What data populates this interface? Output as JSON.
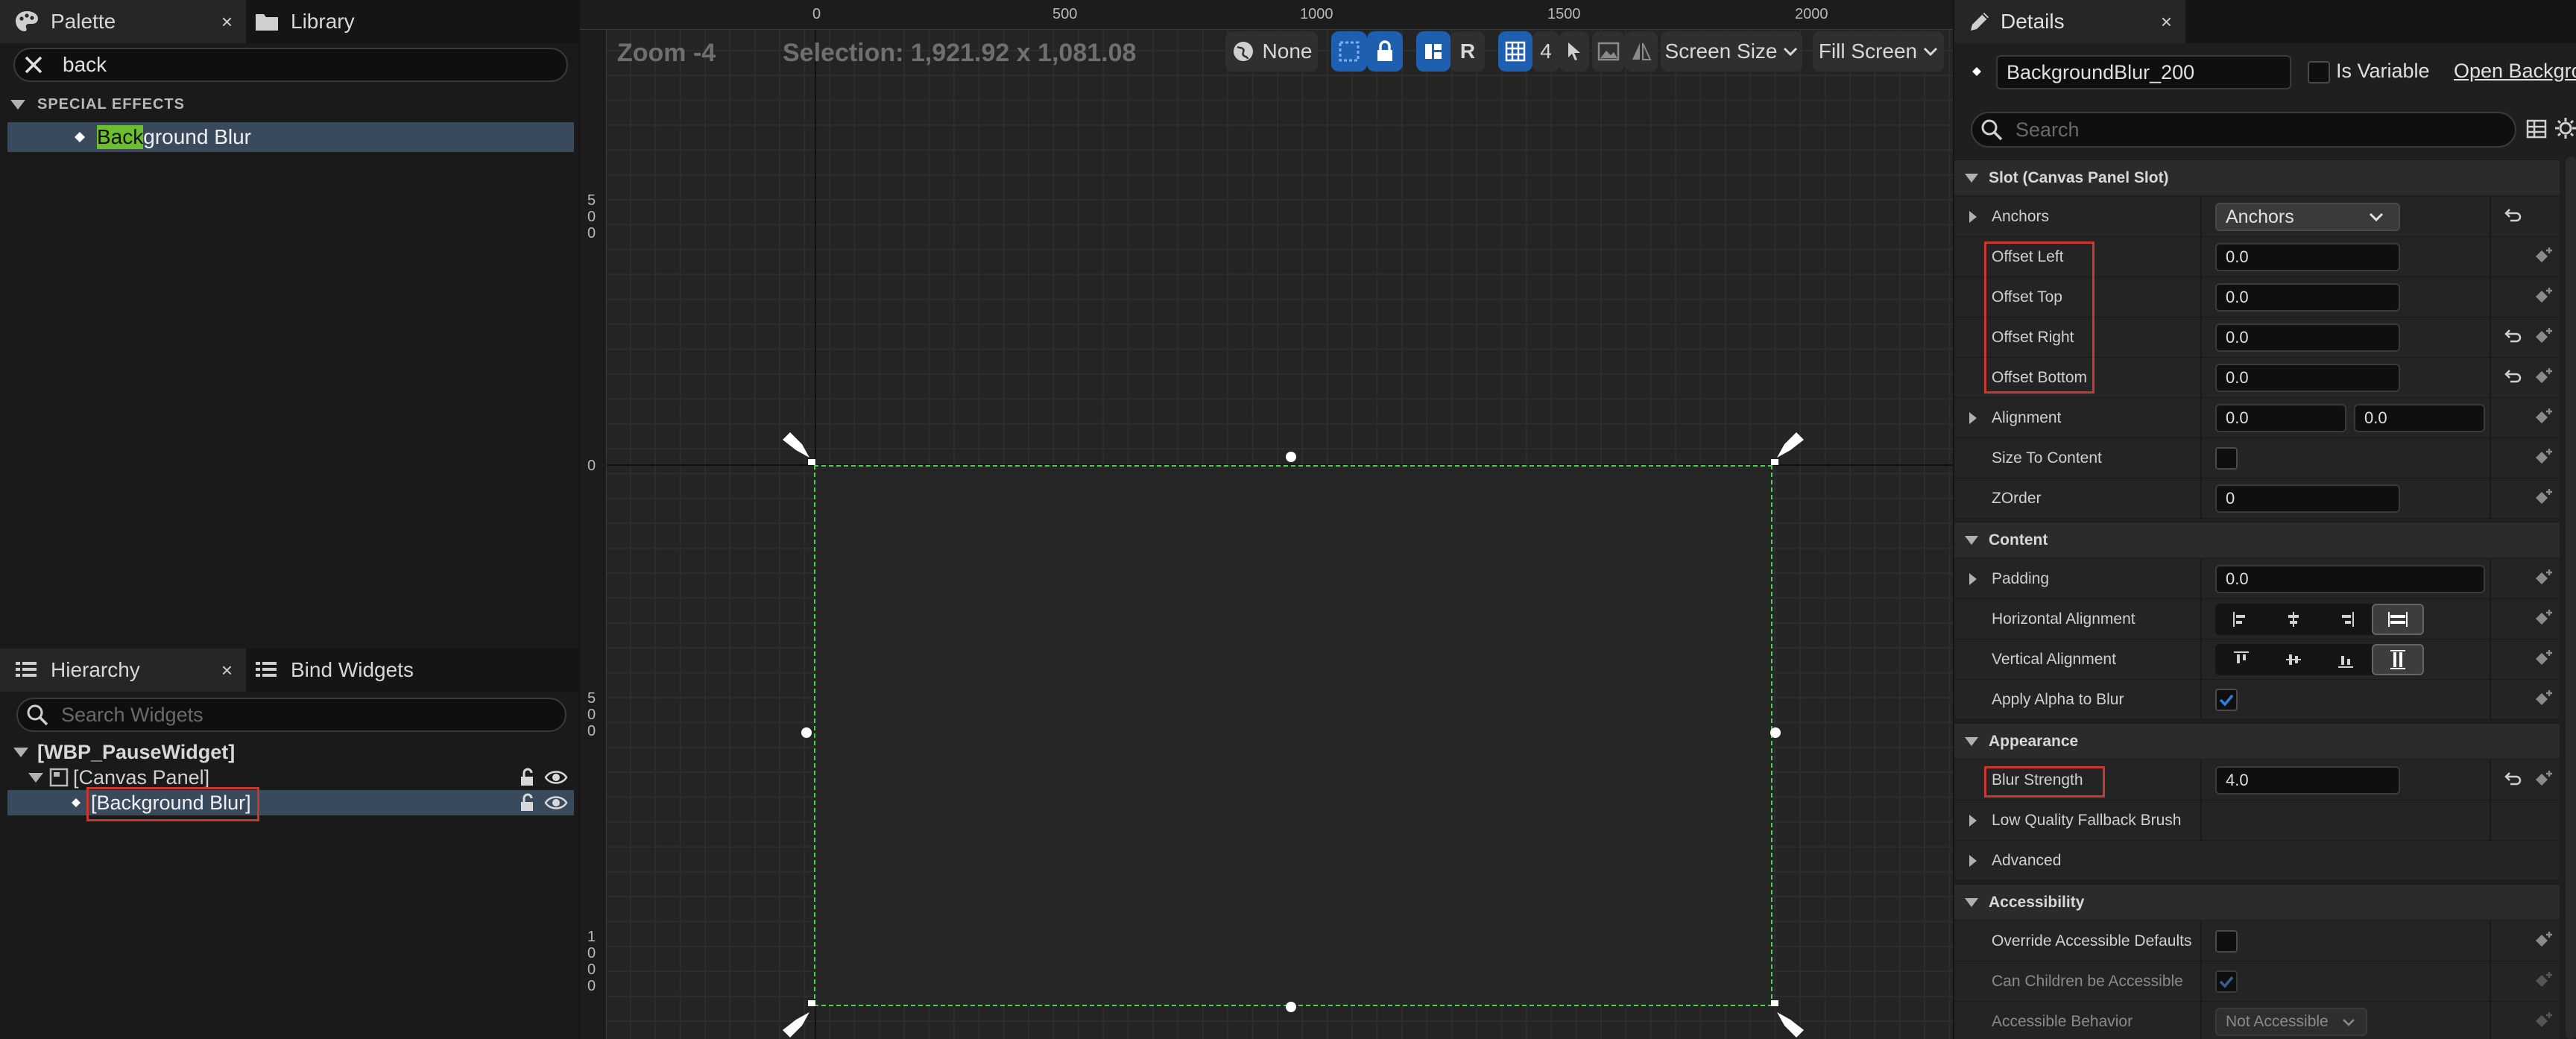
{
  "palette": {
    "tab_label": "Palette",
    "library_tab_label": "Library",
    "close_glyph": "×",
    "search_value": "back",
    "category": "SPECIAL EFFECTS",
    "item_highlight": "Back",
    "item_rest": "ground Blur"
  },
  "hierarchy": {
    "tab_label": "Hierarchy",
    "bind_tab_label": "Bind Widgets",
    "close_glyph": "×",
    "search_placeholder": "Search Widgets",
    "root": "[WBP_PauseWidget]",
    "canvas": "[Canvas Panel]",
    "selected": "[Background Blur]"
  },
  "viewport": {
    "zoom": "Zoom -4",
    "selection": "Selection: 1,921.92 x 1,081.08",
    "ruler_x": [
      "0",
      "500",
      "1000",
      "1500",
      "2000"
    ],
    "ruler_y_0": "0",
    "ruler_y_500": [
      "5",
      "0",
      "0"
    ],
    "ruler_y_500b": [
      "5",
      "0",
      "0"
    ],
    "ruler_y_1000": [
      "1",
      "0",
      "0",
      "0"
    ],
    "toolbar": {
      "none_label": "None",
      "r_label": "R",
      "grid_count": "4",
      "screen_size": "Screen Size",
      "fill_screen": "Fill Screen"
    }
  },
  "details": {
    "tab_label": "Details",
    "close_glyph": "×",
    "widget_name": "BackgroundBlur_200",
    "is_variable": "Is Variable",
    "open_link": "Open Backgro",
    "search_placeholder": "Search",
    "sections": {
      "slot": "Slot (Canvas Panel Slot)",
      "content": "Content",
      "appearance": "Appearance",
      "low_quality": "Low Quality Fallback Brush",
      "advanced": "Advanced",
      "accessibility": "Accessibility"
    },
    "props": {
      "anchors_label": "Anchors",
      "anchors_value": "Anchors",
      "offset_left_label": "Offset Left",
      "offset_left_value": "0.0",
      "offset_top_label": "Offset Top",
      "offset_top_value": "0.0",
      "offset_right_label": "Offset Right",
      "offset_right_value": "0.0",
      "offset_bottom_label": "Offset Bottom",
      "offset_bottom_value": "0.0",
      "alignment_label": "Alignment",
      "alignment_x": "0.0",
      "alignment_y": "0.0",
      "size_to_content_label": "Size To Content",
      "zorder_label": "ZOrder",
      "zorder_value": "0",
      "padding_label": "Padding",
      "padding_value": "0.0",
      "h_align_label": "Horizontal Alignment",
      "v_align_label": "Vertical Alignment",
      "apply_alpha_label": "Apply Alpha to Blur",
      "blur_strength_label": "Blur Strength",
      "blur_strength_value": "4.0",
      "override_acc_label": "Override Accessible Defaults",
      "can_children_label": "Can Children be Accessible",
      "acc_behavior_label": "Accessible Behavior",
      "acc_behavior_value": "Not Accessible"
    }
  },
  "colors": {
    "accent_blue": "#1f5fb0",
    "highlight_green": "#6bbf2c",
    "selection_green": "#4ad24a",
    "annotation_red": "#c8382e"
  }
}
